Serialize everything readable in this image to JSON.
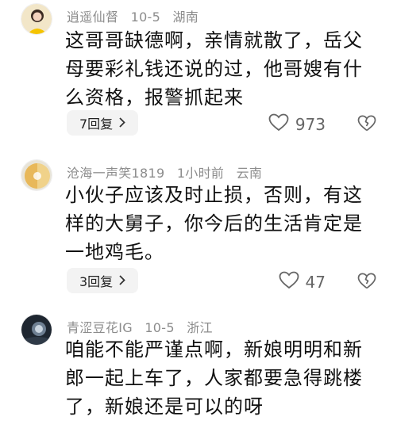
{
  "comments": [
    {
      "username": "逍遥仙督",
      "date": "10-5",
      "location": "湖南",
      "text_lines": [
        "这哥哥缺德啊，亲情就散了，岳父",
        "母要彩礼钱还说的过，他哥嫂有什",
        "么资格，报警抓起来"
      ],
      "reply_label": "7回复",
      "like_count": "973"
    },
    {
      "username": "沧海一声笑1819",
      "date": "1小时前",
      "location": "云南",
      "text_lines": [
        "小伙子应该及时止损，否则，有这",
        "样的大舅子，你今后的生活肯定是",
        "一地鸡毛。"
      ],
      "reply_label": "3回复",
      "like_count": "47"
    },
    {
      "username": "青涩豆花IG",
      "date": "10-5",
      "location": "浙江",
      "text_lines": [
        "咱能不能严谨点啊，新娘明明和新",
        "郎一起上车了，人家都要急得跳楼",
        "了，新娘还是可以的呀"
      ]
    }
  ],
  "colors": {
    "meta": "#8c8c8c",
    "reply_bg": "#f3f3f3"
  },
  "icons": {
    "reply_chevron": "chevron-right-icon",
    "like": "heart-icon",
    "dislike": "broken-heart-icon"
  }
}
